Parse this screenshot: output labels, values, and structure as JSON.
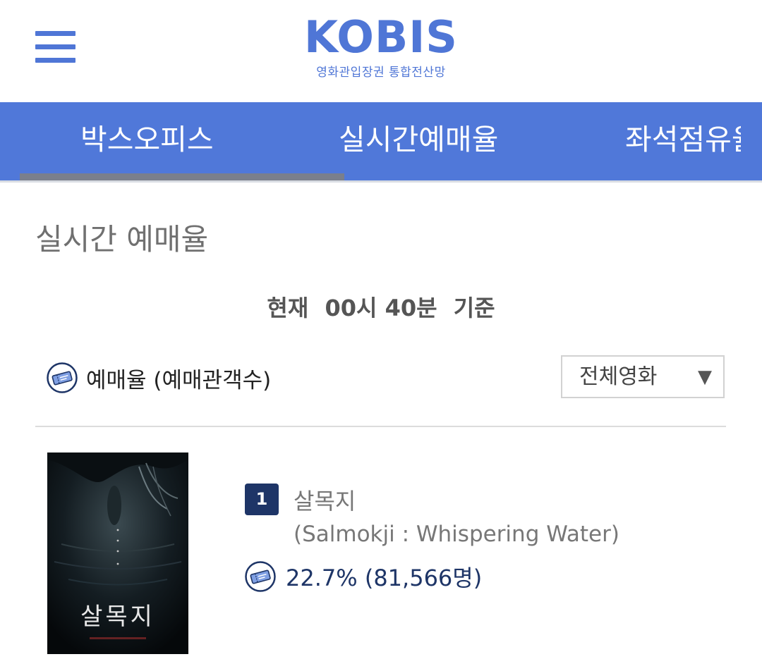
{
  "header": {
    "logo_title": "KOBIS",
    "logo_subtitle": "영화관입장권 통합전산망",
    "menu_icon": "hamburger-menu-icon"
  },
  "nav": {
    "tabs": [
      {
        "label": "박스오피스",
        "active": false
      },
      {
        "label": "실시간예매율",
        "active": true
      },
      {
        "label": "좌석점유율",
        "active": false
      }
    ]
  },
  "page": {
    "title": "실시간 예매율",
    "basis": {
      "prefix": "현재",
      "time": "00시 40분",
      "suffix": "기준"
    },
    "legend": {
      "icon": "ticket-icon",
      "label": "예매율 (예매관객수)"
    },
    "filter": {
      "selected": "전체영화",
      "arrow": "▼"
    }
  },
  "movies": [
    {
      "rank": "1",
      "title": "살목지",
      "title_en": "(Salmokji : Whispering Water)",
      "poster_text": "살목지",
      "rate_text": "22.7% (81,566명)"
    }
  ],
  "colors": {
    "brand": "#4f76d6",
    "navbar": "#5078d9",
    "rank_bg": "#1e3567",
    "indicator": "#7a7f8c"
  }
}
